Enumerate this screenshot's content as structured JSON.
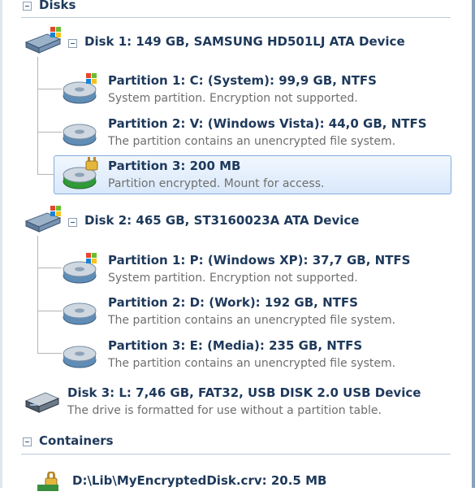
{
  "sections": {
    "disks_header": "Disks",
    "containers_header": "Containers"
  },
  "disks": [
    {
      "title": "Disk 1: 149 GB, SAMSUNG HD501LJ ATA Device",
      "partitions": [
        {
          "title": "Partition 1: C: (System): 99,9 GB, NTFS",
          "subtitle": "System partition. Encryption not supported.",
          "icon": "windows-partition-icon"
        },
        {
          "title": "Partition 2: V: (Windows Vista): 44,0 GB, NTFS",
          "subtitle": "The partition contains an unencrypted file system.",
          "icon": "partition-icon"
        },
        {
          "title": "Partition 3: 200 MB",
          "subtitle": "Partition encrypted. Mount for access.",
          "icon": "encrypted-partition-icon"
        }
      ]
    },
    {
      "title": "Disk 2: 465 GB, ST3160023A ATA Device",
      "partitions": [
        {
          "title": "Partition 1: P: (Windows XP): 37,7 GB, NTFS",
          "subtitle": "System partition. Encryption not supported.",
          "icon": "windows-partition-icon"
        },
        {
          "title": "Partition 2: D: (Work): 192 GB, NTFS",
          "subtitle": "The partition contains an unencrypted file system.",
          "icon": "partition-icon"
        },
        {
          "title": "Partition 3: E: (Media): 235 GB, NTFS",
          "subtitle": "The partition contains an unencrypted file system.",
          "icon": "partition-icon"
        }
      ]
    },
    {
      "title": "Disk 3: L: 7,46 GB, FAT32, USB DISK 2.0 USB Device",
      "subtitle": "The drive is formatted for use without a partition table."
    }
  ],
  "containers": [
    {
      "title": "D:\\Lib\\MyEncryptedDisk.crv: 20.5 MB"
    }
  ],
  "colors": {
    "text_primary": "#1e395b",
    "text_secondary": "#6e6e6e",
    "selection_border": "#84acdd"
  }
}
